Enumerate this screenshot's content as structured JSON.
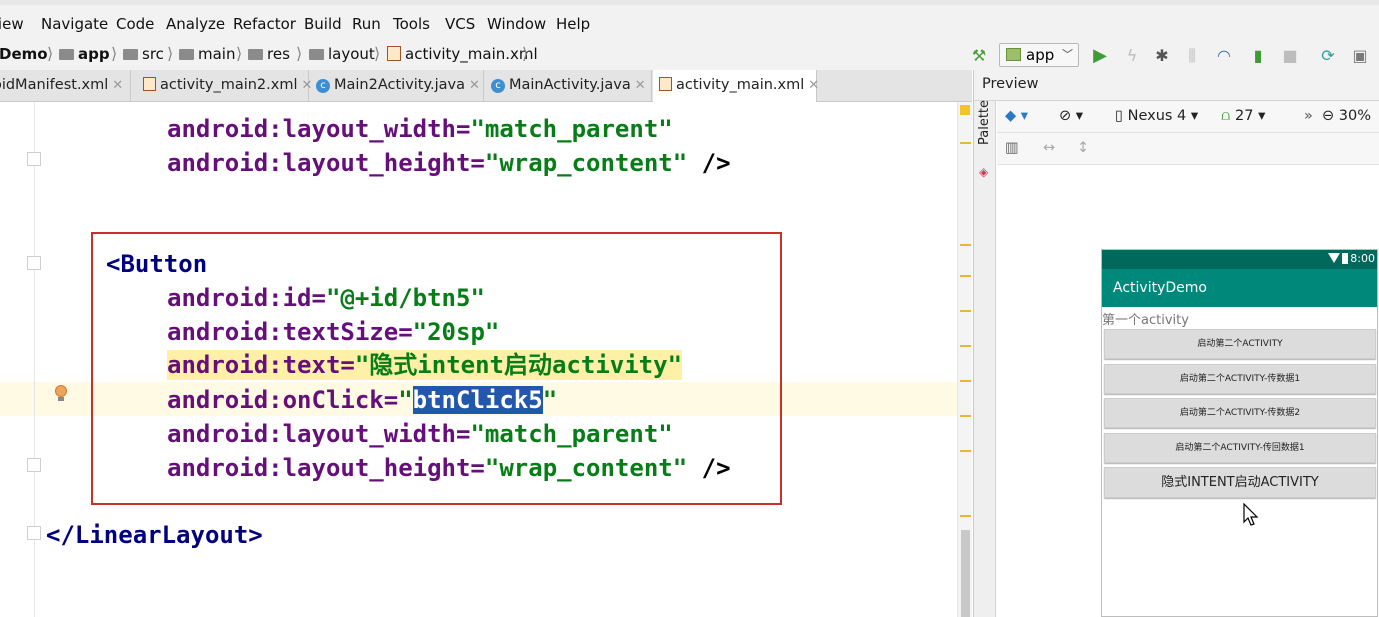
{
  "menu": {
    "items": [
      "View",
      "Navigate",
      "Code",
      "Analyze",
      "Refactor",
      "Build",
      "Run",
      "Tools",
      "VCS",
      "Window",
      "Help"
    ]
  },
  "breadcrumb": {
    "project": "Demo",
    "items": [
      "app",
      "src",
      "main",
      "res",
      "layout",
      "activity_main.xml"
    ]
  },
  "run_config": {
    "label": "app"
  },
  "tabs": [
    {
      "label": "AndroidManifest.xml",
      "active": false
    },
    {
      "label": "activity_main2.xml",
      "active": false
    },
    {
      "label": "Main2Activity.java",
      "active": false
    },
    {
      "label": "MainActivity.java",
      "active": false
    },
    {
      "label": "activity_main.xml",
      "active": true
    }
  ],
  "code": {
    "attr_layout_width": "android:layout_width=",
    "attr_layout_height": "android:layout_height=",
    "match_parent": "\"match_parent\"",
    "wrap_content": "\"wrap_content\"",
    "close_tag": " />",
    "button_open": "<",
    "button_tag": "Button",
    "attr_id": "android:id=",
    "val_id": "\"@+id/btn5\"",
    "attr_textsize": "android:textSize=",
    "val_textsize": "\"20sp\"",
    "attr_text": "android:text=",
    "val_text": "\"隐式intent启动activity\"",
    "attr_onclick": "android:onClick=",
    "quote": "\"",
    "val_onclick": "btnClick5",
    "linear_open": "</",
    "linear_tag": "LinearLayout",
    "linear_close": ">"
  },
  "preview": {
    "title": "Preview",
    "palette": "Palette",
    "device": "Nexus 4",
    "api": "27",
    "zoom": "30%",
    "phone": {
      "time": "8:00",
      "app_title": "ActivityDemo",
      "first_text": "第一个activity",
      "buttons": [
        "启动第二个ACTIVITY",
        "启动第二个ACTIVITY-传数据1",
        "启动第二个ACTIVITY-传数据2",
        "启动第二个ACTIVITY-传回数据1",
        "隐式INTENT启动ACTIVITY"
      ]
    }
  }
}
